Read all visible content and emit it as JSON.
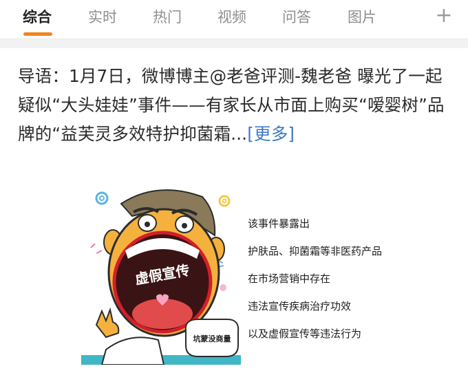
{
  "tabs": [
    {
      "label": "综合",
      "active": true
    },
    {
      "label": "实时",
      "active": false
    },
    {
      "label": "热门",
      "active": false
    },
    {
      "label": "视频",
      "active": false
    },
    {
      "label": "问答",
      "active": false
    },
    {
      "label": "图片",
      "active": false
    }
  ],
  "tab_add_icon": "plus-icon",
  "accent_color": "#f0831e",
  "link_color": "#3a78c8",
  "post": {
    "intro": "导语：1月7日，微博博主@老爸评测-魏老爸 曝光了一起疑似“大头娃娃”事件——有家长从市面上购买“嗳婴树”品牌的“益芙灵多效特护抑菌霜...",
    "more_label": "[更多]"
  },
  "image": {
    "mouth_text": "虚假宣传",
    "bubble_text": "坑蒙没商量",
    "captions": [
      "该事件暴露出",
      "护肤品、抑菌霜等非医药产品",
      "在市场营销中存在",
      "违法宣传疾病治疗功效",
      "以及虚假宣传等违法行为"
    ]
  }
}
